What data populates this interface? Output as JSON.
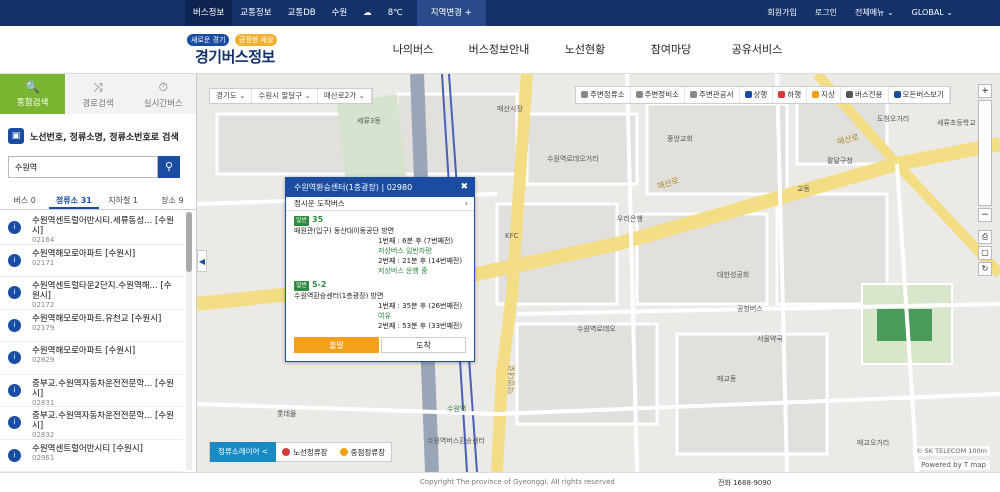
{
  "topbar": {
    "nav": [
      "버스정보",
      "교통정보",
      "교통DB",
      "수원",
      "☁",
      "8℃"
    ],
    "region": "지역변경 +",
    "util": [
      "회원가입",
      "로그인",
      "전체메뉴 ⌄",
      "GLOBAL ⌄"
    ]
  },
  "header": {
    "logo_tag1": "새로운 경기",
    "logo_tag2": "공정한 세상",
    "logo_main": "경기버스정보",
    "menu": [
      "나의버스",
      "버스정보안내",
      "노선현황",
      "참여마당",
      "공유서비스"
    ]
  },
  "sidebar": {
    "tabs": [
      {
        "icon": "🔍",
        "label": "통합검색"
      },
      {
        "icon": "⤨",
        "label": "경로검색"
      },
      {
        "icon": "⏱",
        "label": "실시간버스"
      }
    ],
    "search_title": "노선번호, 정류소명, 정류소번호로 검색",
    "search_value": "수원역",
    "result_tabs": [
      "버스 0",
      "정류소 31",
      "지하철 1",
      "장소 9"
    ],
    "results": [
      {
        "num": "i",
        "name": "수원역센트럴어반시티.세류동성... [수원시]",
        "id": "02164"
      },
      {
        "num": "i",
        "name": "수원역해모로아파트 [수원시]",
        "id": "02171"
      },
      {
        "num": "i",
        "name": "수원역센트럴타운2단지.수원역해... [수원시]",
        "id": "02172"
      },
      {
        "num": "i",
        "name": "수원역해모로아파트.유천교 [수원시]",
        "id": "02179"
      },
      {
        "num": "i",
        "name": "수원역해모로아파트 [수원시]",
        "id": "02829"
      },
      {
        "num": "i",
        "name": "중부교.수원역자동차운전전문학... [수원시]",
        "id": "02831"
      },
      {
        "num": "i",
        "name": "중부교.수원역자동차운전전문학... [수원시]",
        "id": "02832"
      },
      {
        "num": "i",
        "name": "수원역센트럴어반시티 [수원시]",
        "id": "02961"
      }
    ]
  },
  "map": {
    "crumb": [
      "경기도 ⌄",
      "수원시 팔달구 ⌄",
      "매산로2가 ⌄"
    ],
    "layers": [
      {
        "label": "주변정류소",
        "color": "#888888"
      },
      {
        "label": "주변정비소",
        "color": "#888888"
      },
      {
        "label": "주변관공서",
        "color": "#888888"
      },
      {
        "label": "상행",
        "color": "#1a4da2"
      },
      {
        "label": "하행",
        "color": "#d33b3b"
      },
      {
        "label": "지상",
        "color": "#f5a01a"
      },
      {
        "label": "버스전용",
        "color": "#555555"
      },
      {
        "label": "모든버스보기",
        "color": "#1a4da2"
      }
    ],
    "labels": [
      {
        "t": "매산로",
        "c": "road"
      },
      {
        "t": "매산로",
        "c": "road"
      },
      {
        "t": "덕영대로",
        "c": "road"
      },
      {
        "t": "수원역",
        "c": "poi"
      },
      {
        "t": "롯데몰",
        "c": ""
      },
      {
        "t": "세류3동",
        "c": ""
      },
      {
        "t": "매산시장",
        "c": ""
      },
      {
        "t": "수원역로데오거리",
        "c": ""
      },
      {
        "t": "KFC",
        "c": ""
      },
      {
        "t": "도청오거리",
        "c": ""
      },
      {
        "t": "세류초등학교",
        "c": ""
      },
      {
        "t": "교동",
        "c": ""
      },
      {
        "t": "매교동",
        "c": ""
      },
      {
        "t": "팔달구청",
        "c": ""
      },
      {
        "t": "중앙교회",
        "c": ""
      },
      {
        "t": "수원역버스환승센터",
        "c": ""
      },
      {
        "t": "대한성공회",
        "c": ""
      },
      {
        "t": "서울약국",
        "c": ""
      },
      {
        "t": "우리은행",
        "c": ""
      },
      {
        "t": "매교오거리",
        "c": ""
      },
      {
        "t": "공항버스",
        "c": ""
      },
      {
        "t": "수원역로데오",
        "c": ""
      }
    ],
    "legend_button": "정류소레이어 <",
    "legend": [
      {
        "label": "노선정류장",
        "color": "#d33b3b"
      },
      {
        "label": "중점정류장",
        "color": "#f5a01a"
      }
    ],
    "copyright": "© SK TELECOM  100m",
    "tmap": "Powered by T map"
  },
  "popup": {
    "title": "수원역환승센터(1층광장) | 02980",
    "subtitle": "정시운 도착버스",
    "routes": [
      {
        "tag": "일반",
        "no": "35",
        "dest": "매원관(입구) 동산대이동공단 방면",
        "line1a": "1번째 : 6분 후 (7번째전)",
        "line1b": "저상버스 일반차량",
        "line2a": "2번째 : 21분 후 (14번째전)",
        "line2b": "저상버스 운행 중"
      },
      {
        "tag": "일반",
        "no": "5-2",
        "dest": "수원역환승센터(1층광장) 방면",
        "line1a": "1번째 : 35분 후 (26번째전)",
        "line1b": "여유",
        "line2a": "2번째 : 53분 후 (33번째전)",
        "line2b": ""
      }
    ],
    "btn_depart": "출발",
    "btn_arrive": "도착"
  },
  "footer": {
    "copyright": "Copyright The province of Gyeonggi. All rights reserved",
    "phone": "전화 1688-9090"
  }
}
